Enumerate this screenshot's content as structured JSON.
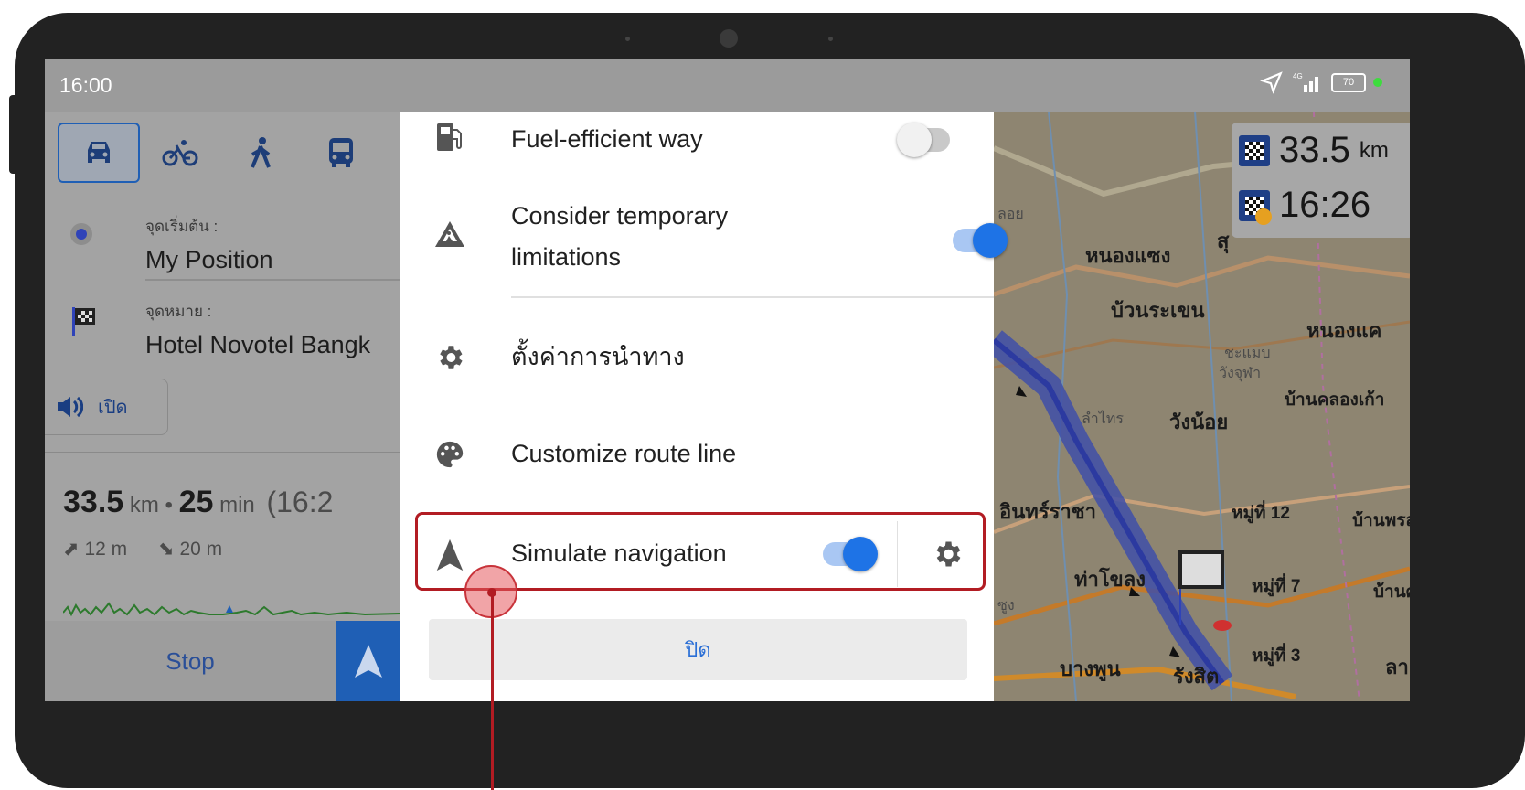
{
  "status": {
    "time": "16:00",
    "battery": "70"
  },
  "route_panel": {
    "start_label": "จุดเริ่มต้น :",
    "start_value": "My Position",
    "dest_label": "จุดหมาย :",
    "dest_value": "Hotel Novotel Bangk",
    "sound_label": "เปิด",
    "distance": "33.5",
    "distance_unit": "km",
    "separator": "•",
    "duration": "25",
    "duration_unit": "min",
    "arrival": "(16:2",
    "ascent": "12 m",
    "descent": "20 m",
    "stop_label": "Stop",
    "modes": [
      "car-icon",
      "bicycle-icon",
      "walk-icon",
      "bus-icon"
    ]
  },
  "dialog": {
    "options": [
      {
        "label": "Fuel-efficient way",
        "icon": "fuel-pump-icon",
        "toggle": false
      },
      {
        "label": "Consider temporary limitations",
        "icon": "road-works-icon",
        "toggle": true
      },
      {
        "label": "ตั้งค่าการนำทาง",
        "icon": "gear-icon"
      },
      {
        "label": "Customize route line",
        "icon": "palette-icon"
      },
      {
        "label": "Simulate navigation",
        "icon": "navigation-arrow-icon",
        "toggle": true
      }
    ],
    "close_label": "ปิด"
  },
  "map": {
    "remaining_distance": "33.5",
    "remaining_unit": "km",
    "eta": "16:26",
    "labels": [
      "หนองแซง",
      "บ้วนระเขน",
      "หนองแค",
      "วังน้อย",
      "บ้านคลองเก้า",
      "อินทร์ราชา",
      "หมู่ที่ 12",
      "บ้านพรสา",
      "ท่าโขลง",
      "หมู่ที่ 7",
      "บ้านศรี",
      "หมู่ที่ 3",
      "บางพูน",
      "รังสิต",
      "ลาดส",
      "สุ"
    ],
    "small_labels": [
      "ลอย",
      "ชะแมบ",
      "วังจุฬา",
      "ลำไทร",
      "ซูง"
    ]
  },
  "colors": {
    "accent": "#1e73e6",
    "highlight": "#b21c23"
  }
}
